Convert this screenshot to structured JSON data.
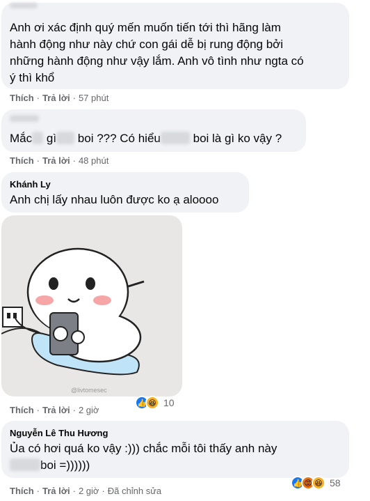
{
  "comments": [
    {
      "author": "",
      "lines": [
        "Anh ơi xác định quý mến muốn tiến tới thì hãng làm",
        "hành động như này chứ con gái dễ bị rung động bởi",
        "những hành động như vậy lắm. Anh vô tình như ngta có",
        "ý thì khổ"
      ],
      "like": "Thích",
      "reply": "Trả lời",
      "time": "57 phút"
    },
    {
      "author": "",
      "segments": [
        "Mắc",
        "gì",
        "boi ??? Có hiểu",
        "boi là gì ko vậy ?"
      ],
      "like": "Thích",
      "reply": "Trả lời",
      "time": "48 phút"
    },
    {
      "author": "Khánh Ly",
      "lines": [
        "Anh chị lấy nhau luôn được ko ạ aloooo"
      ],
      "sticker_watermark": "@livtomesec",
      "like": "Thích",
      "reply": "Trả lời",
      "time": "2 giờ",
      "reaction_count": "10"
    },
    {
      "author": "Nguyễn Lê Thu Hương",
      "line1": "Ủa có hơi quá ko vậy :))) chắc mỗi tôi thấy anh này",
      "line2_end": "boi =))))))",
      "like": "Thích",
      "reply": "Trả lời",
      "time": "2 giờ",
      "edited": "Đã chỉnh sửa",
      "reaction_count": "58"
    }
  ],
  "colors": {
    "bubble": "#f0f2f5",
    "meta": "#65676b",
    "like_blue": "#1877f2",
    "haha_yellow": "#f7b125",
    "angry_red": "#e9710f"
  },
  "icons": [
    "like-icon",
    "haha-icon",
    "angry-icon"
  ]
}
